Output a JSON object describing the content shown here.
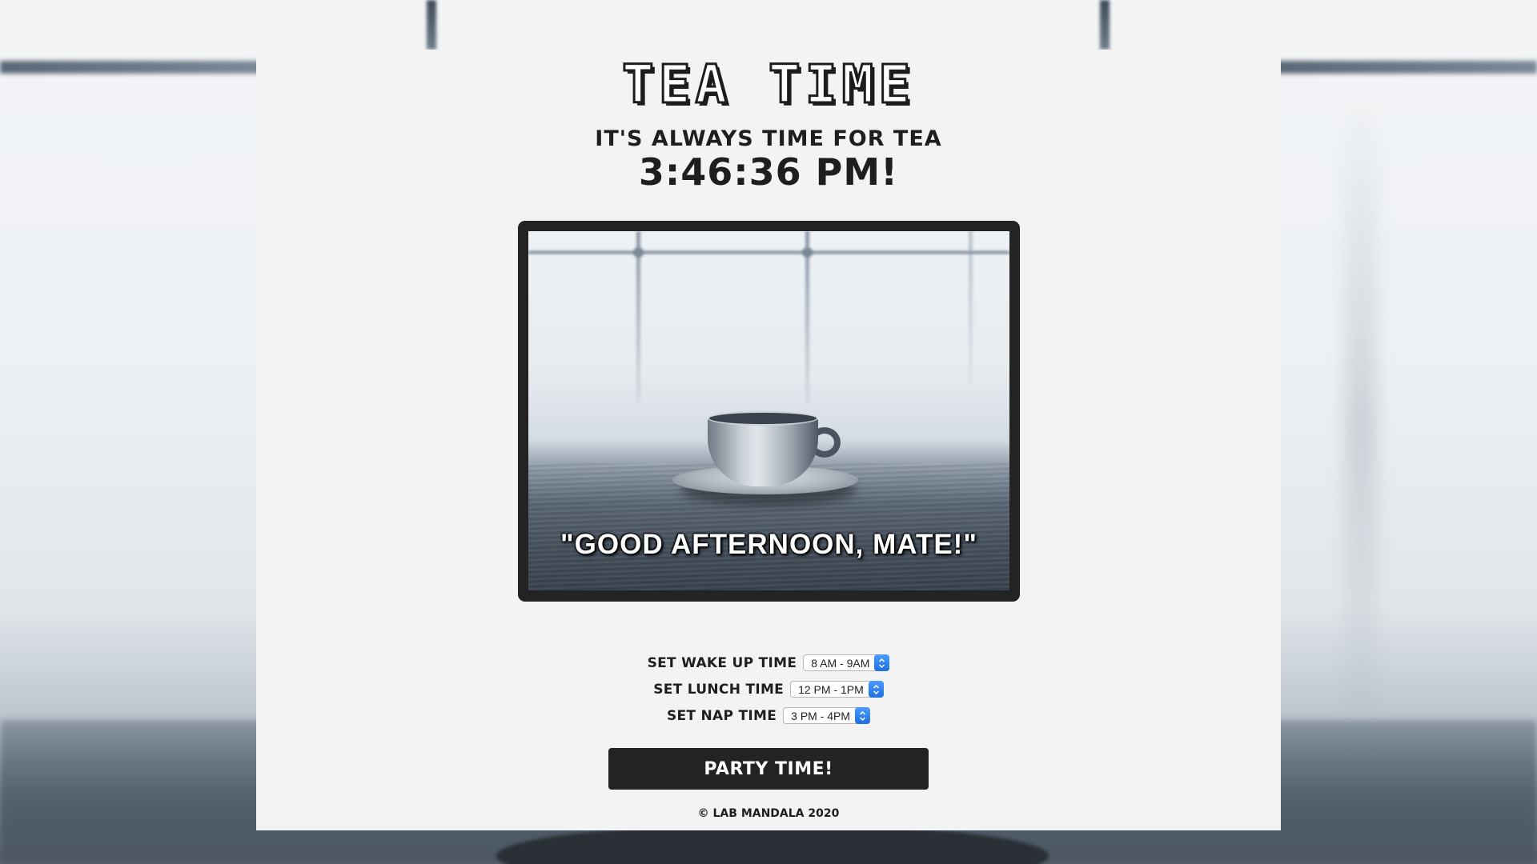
{
  "app": {
    "logo_text": "TEA TIME",
    "tagline": "IT'S ALWAYS TIME FOR TEA",
    "clock_display": "3:46:36 PM!"
  },
  "hero": {
    "image_subject": "teacup-on-table-photo",
    "caption": "\"GOOD AFTERNOON, MATE!\""
  },
  "settings": [
    {
      "label": "SET WAKE UP TIME",
      "selected": "8 AM - 9AM"
    },
    {
      "label": "SET LUNCH TIME",
      "selected": "12 PM - 1PM"
    },
    {
      "label": "SET NAP TIME",
      "selected": "3 PM - 4PM"
    }
  ],
  "actions": {
    "party_label": "PARTY TIME!"
  },
  "footer": {
    "copyright": "© LAB MANDALA 2020"
  },
  "colors": {
    "card_background": "#f3f3f3",
    "text_dark": "#1e1e1e",
    "button_background": "#232323",
    "select_accent": "#1e6fe0"
  }
}
